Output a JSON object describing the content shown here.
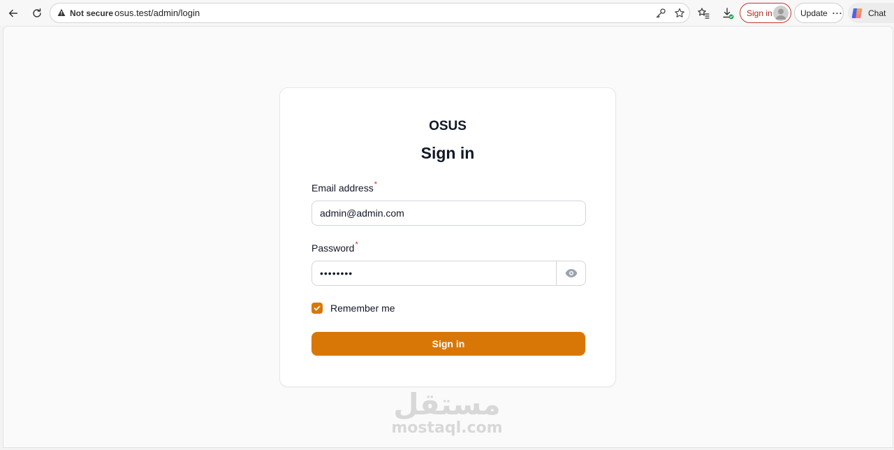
{
  "browser": {
    "security_label": "Not secure",
    "url": "osus.test/admin/login",
    "signin_label": "Sign in",
    "update_label": "Update",
    "update_dots": "···",
    "chat_label": "Chat"
  },
  "login": {
    "brand": "OSUS",
    "title": "Sign in",
    "email_label": "Email address",
    "email_required": "*",
    "email_value": "admin@admin.com",
    "password_label": "Password",
    "password_required": "*",
    "password_value": "password",
    "remember_label": "Remember me",
    "remember_checked": true,
    "submit_label": "Sign in"
  },
  "colors": {
    "accent": "#d97706",
    "required": "#dc2626"
  },
  "watermark": {
    "arabic": "مستقل",
    "latin": "mostaql.com"
  }
}
